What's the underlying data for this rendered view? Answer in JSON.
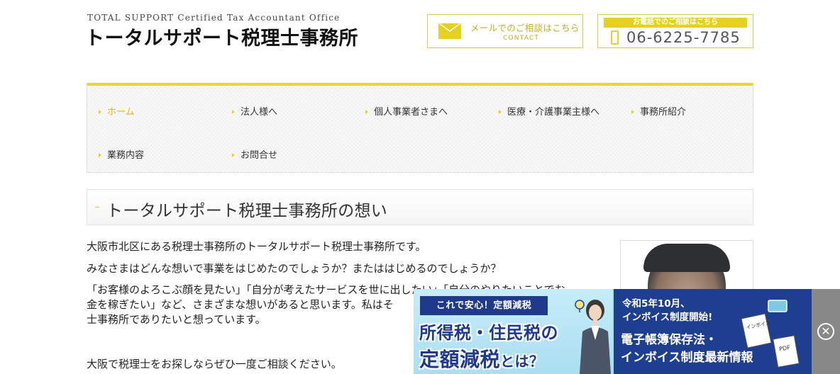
{
  "header": {
    "logo_sub": "TOTAL SUPPORT Certified Tax Accountant Office",
    "logo_main": "トータルサポート税理士事務所",
    "mail_button": {
      "label": "メールでのご相談はこちら",
      "sub": "CONTACT"
    },
    "tel_box": {
      "label": "お電話でのご相談はこちら",
      "number": "06-6225-7785"
    }
  },
  "nav": {
    "items": [
      {
        "label": "ホーム",
        "active": true
      },
      {
        "label": "法人様へ"
      },
      {
        "label": "個人事業者さまへ"
      },
      {
        "label": "医療・介護事業主様へ"
      },
      {
        "label": "事務所紹介"
      },
      {
        "label": "業務内容"
      },
      {
        "label": "お問合せ"
      }
    ]
  },
  "main": {
    "heading": "トータルサポート税理士事務所の想い",
    "paragraphs": [
      "大阪市北区にある税理士事務所のトータルサポート税理士事務所です。",
      "みなさまはどんな想いで事業をはじめたのでしょうか？またははじめるのでしょうか？",
      "「お客様のよろこぶ顔を見たい」「自分が考えたサービスを世に出したい」「自分のやりたいことでお",
      "金を稼ぎたい」など、さまざまな想いがあると思います。私はそ",
      "士事務所でありたいと想っています。",
      "大阪で税理士をお探しならぜひ一度ご相談ください。"
    ]
  },
  "ad": {
    "tag": "これで安心！定額減税",
    "line1": "所得税・住民税の",
    "line2_main": "定額減税",
    "line2_small": "とは？",
    "right_line1": "令和5年10月、",
    "right_line2": "インボイス制度開始!",
    "right_line3": "電子帳簿保存法・",
    "right_line4": "インボイス制度最新情報",
    "doc_label1": "インボイス",
    "doc_label2": "PDF",
    "close": "✕"
  },
  "colors": {
    "accent": "#e6d21e",
    "ad_navy": "#1e3f8f",
    "ad_sky": "#a9dff2"
  }
}
